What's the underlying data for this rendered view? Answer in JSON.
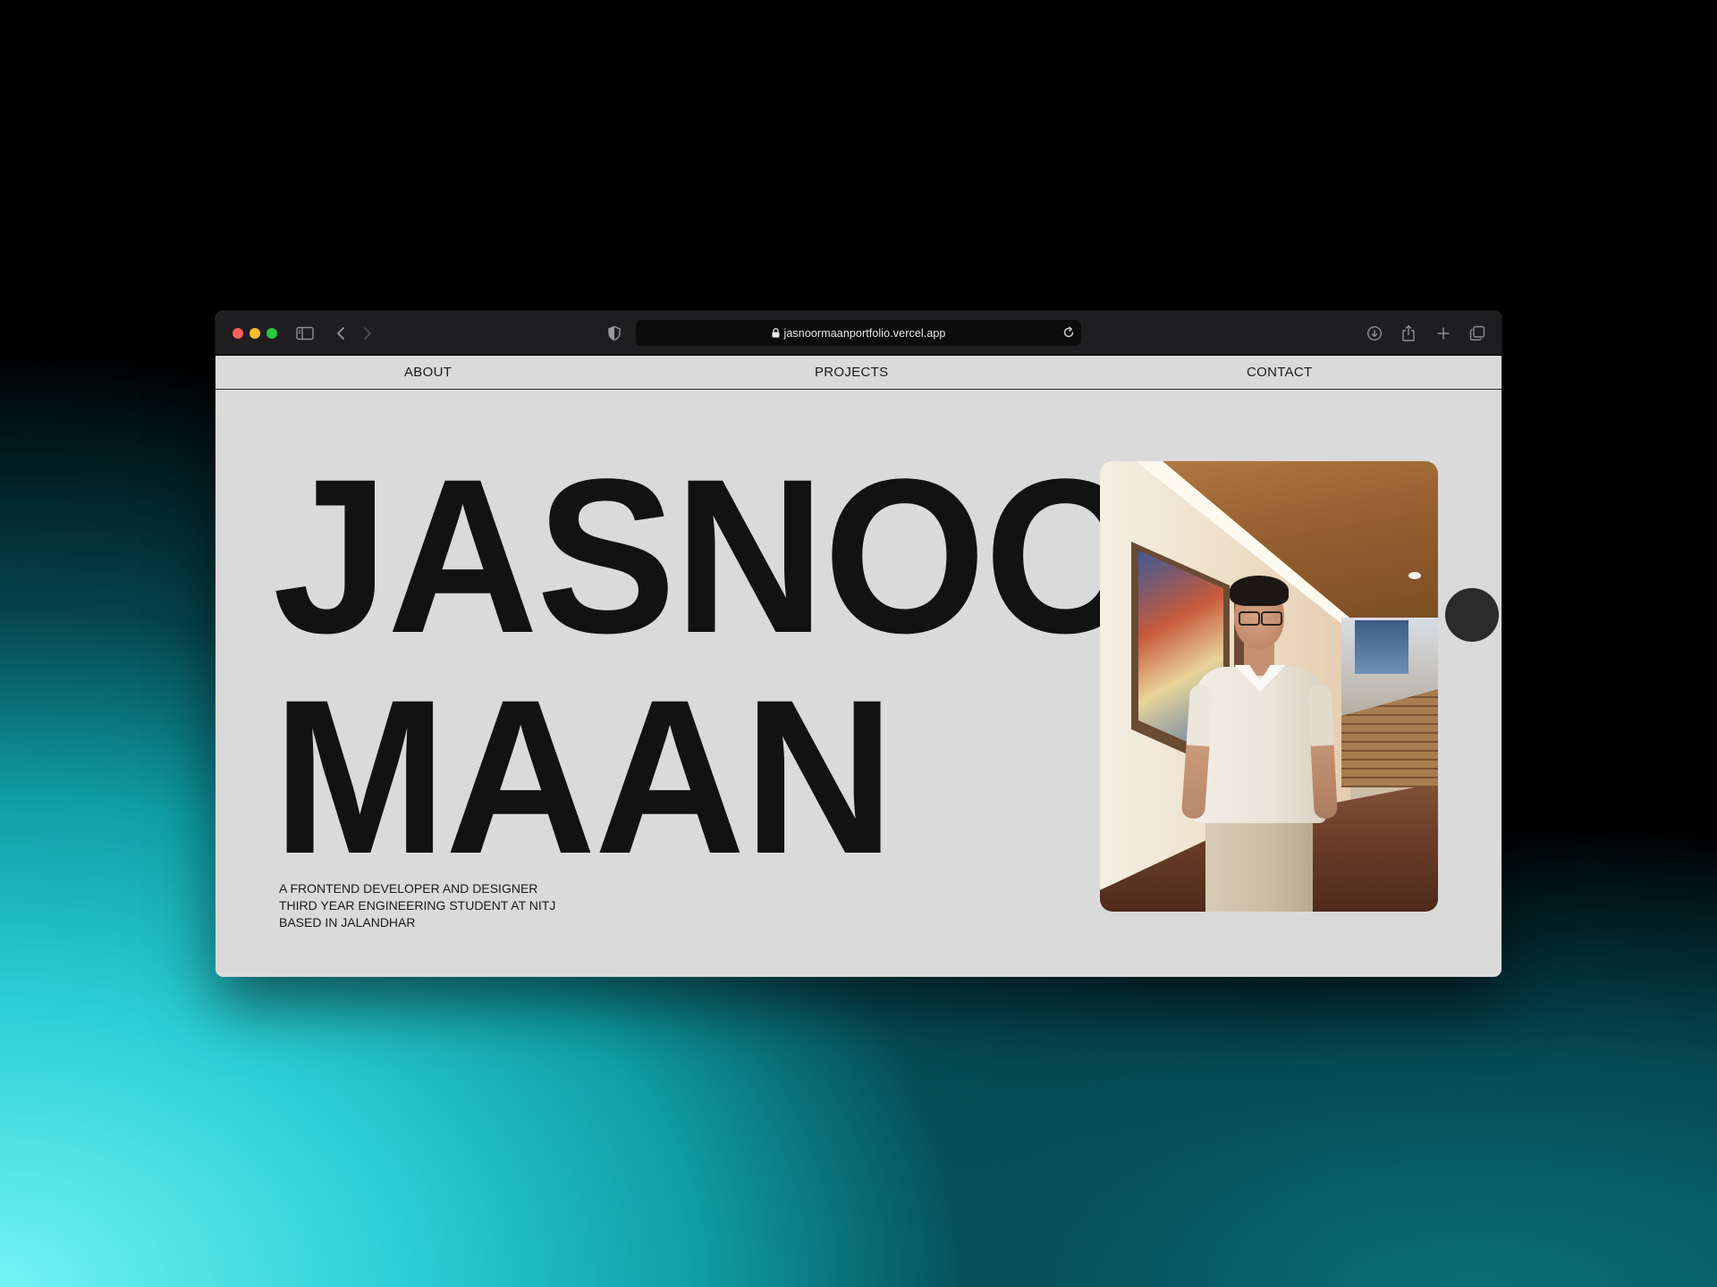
{
  "browser": {
    "url": "jasnoormaanportfolio.vercel.app",
    "icons": [
      "sidebar-icon",
      "back-icon",
      "forward-icon",
      "shield-icon",
      "lock-icon",
      "reload-icon",
      "download-icon",
      "share-icon",
      "new-tab-icon",
      "tabs-overview-icon"
    ]
  },
  "nav": {
    "about": "ABOUT",
    "projects": "PROJECTS",
    "contact": "CONTACT"
  },
  "hero": {
    "first_name": "JASNOOR",
    "last_name": "MAAN",
    "bio": [
      "A FRONTEND DEVELOPER AND DESIGNER",
      "THIRD YEAR ENGINEERING STUDENT AT NITJ",
      "BASED IN JALANDHAR"
    ]
  },
  "colors": {
    "page_background": "#dadada",
    "text": "#121212",
    "toolbar": "#1e1e20",
    "cursor_dot": "#2b2b2b"
  }
}
